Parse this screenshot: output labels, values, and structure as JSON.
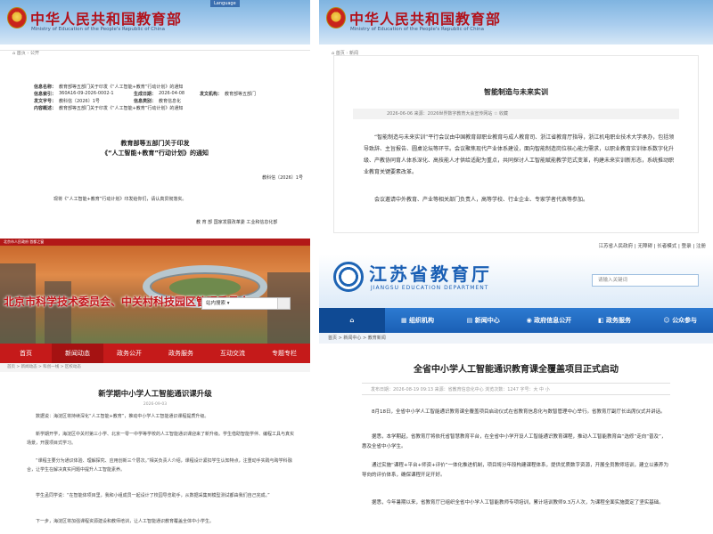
{
  "moe": {
    "title": "中华人民共和国教育部",
    "subtitle": "Ministry of Education of the People's Republic of China",
    "lang": "Language"
  },
  "panel1": {
    "breadcrumb": [
      "首页",
      "公开"
    ],
    "meta": [
      {
        "label": "信息名称：",
        "value": "教育部等五部门关于印发《“人工智能+教育”行动计划》的通知"
      },
      {
        "label": "信息索引：",
        "value": "360A16-09-2026-0002-1",
        "label2": "生成日期：",
        "value2": "2026-04-08",
        "label3": "发文机构：",
        "value3": "教育部等五部门"
      },
      {
        "label": "发文字号：",
        "value": "教科信〔2026〕1号",
        "label2": "信息类别：",
        "value2": "教育信息化"
      },
      {
        "label": "内容概述：",
        "value": "教育部等五部门关于印发《“人工智能+教育”行动计划》的通知"
      }
    ],
    "heading1": "教育部等五部门关于印发",
    "heading2": "《“人工智能+教育”行动计划》的通知",
    "doc_number": "教科信〔2026〕1号",
    "body": "现将《“人工智能+教育”行动计划》印发给你们，请认真贯彻落实。",
    "signature": "教 育 部   国家发展改革委   工业和信息化部"
  },
  "panel2": {
    "breadcrumb": [
      "首页",
      "新闻"
    ],
    "title": "智能制造与未来实训",
    "meta": "2026-06-06   来源：2026世界数字教育大会宣传网站   ☆ 收藏",
    "para1": "“智能制造与未来实训”平行会议由中国教育部职业教育与成人教育司、浙江省教育厅指导，浙江机电职业技术大学承办，包括领导致辞、主旨报告、圆桌论坛等环节。会议聚焦现代产业体系建设，面向智能制造岗位核心能力需求，以职业教育实训体系数字化升级、产教协同育人体系深化、高技能人才供给适配为重点，共同探讨人工智能赋能教学范式变革，构建未来实训新形态，系统推动职业教育关键要素改革。",
    "para2": "会议邀请中外教育、产业等相关部门负责人，高等学校、行业企业、专家学者代表等参加。"
  },
  "panel3": {
    "topbar": "北京市人民政府   首都之窗",
    "site_title": "北京市科学技术委员会、中关村科技园区管理委员会",
    "search_label": "站内搜索",
    "nav": [
      "首页",
      "新闻动态",
      "政务公开",
      "政务服务",
      "互动交流",
      "专题专栏"
    ],
    "breadcrumb": "首页 > 新闻动态 > 科创一线 > 区校动态",
    "title": "新学期中小学人工智能通识课升级",
    "date": "2026-09-03",
    "paras": [
      "数据说：海淀区将持续深化“人工智能+教育”，推动中小学人工智能通识课程提质升级。",
      "新学期开学，海淀区中关村第三小学、北京一零一中学等学校的人工智能通识课迎来了新升级。学生借助智能学伴、编程工具与真实场景，开展项目式学习。",
      "“课程主要分为通识体验、理解探究、应用创新三个层次。”相关负责人介绍，课程设计紧扣学生认知特点，注重动手实践与跨学科融合，让学生在解决真实问题中提升人工智能素养。",
      "学生孟同学说：“在智能体项目里，我和小组成员一起设计了校园导览助手，从数据采集到模型测试都由我们自己完成。”",
      "下一步，海淀区将加强课程资源建设和教师培训，让人工智能通识教育覆盖全体中小学生。"
    ]
  },
  "panel4": {
    "top_links": "江苏省人民政府 | 无障碍 | 长者模式 | 登录 | 注册",
    "title": "江苏省教育厅",
    "subtitle": "JIANGSU EDUCATION DEPARTMENT",
    "search_placeholder": "请输入关键词",
    "nav": [
      "组织机构",
      "新闻中心",
      "政府信息公开",
      "政务服务",
      "公众参与"
    ],
    "breadcrumb": "首页 > 新闻中心 > 教育新闻",
    "title2": "全省中小学人工智能通识教育课全覆盖项目正式启动",
    "meta": "发布日期：2026-08-19 09:13   来源：省教育信息化中心   浏览次数：1247   字号：大 中 小",
    "paras": [
      "8月18日，全省中小学人工智能通识教育课全覆盖项目启动仪式在省教育信息化与数智管理中心举行。省教育厅副厅长出席仪式并讲话。",
      "据悉，本学期起，省教育厅将依托省智慧教育平台，在全省中小学开设人工智能通识教育课程，推动人工智能教育由“选修”走向“普及”，惠及全省中小学生。",
      "通过实施“课程+平台+师资+评价”一体化推进机制，项目将分年段构建课程体系，提供优质数字资源，开展全员教师培训，建立以素养为导向的评价体系，确保课程开足开好。",
      "据悉，今年暑期以来，省教育厅已组织全省中小学人工智能教师专项培训，累计培训教师9.3万人次，为课程全面实施奠定了坚实基础。"
    ]
  }
}
